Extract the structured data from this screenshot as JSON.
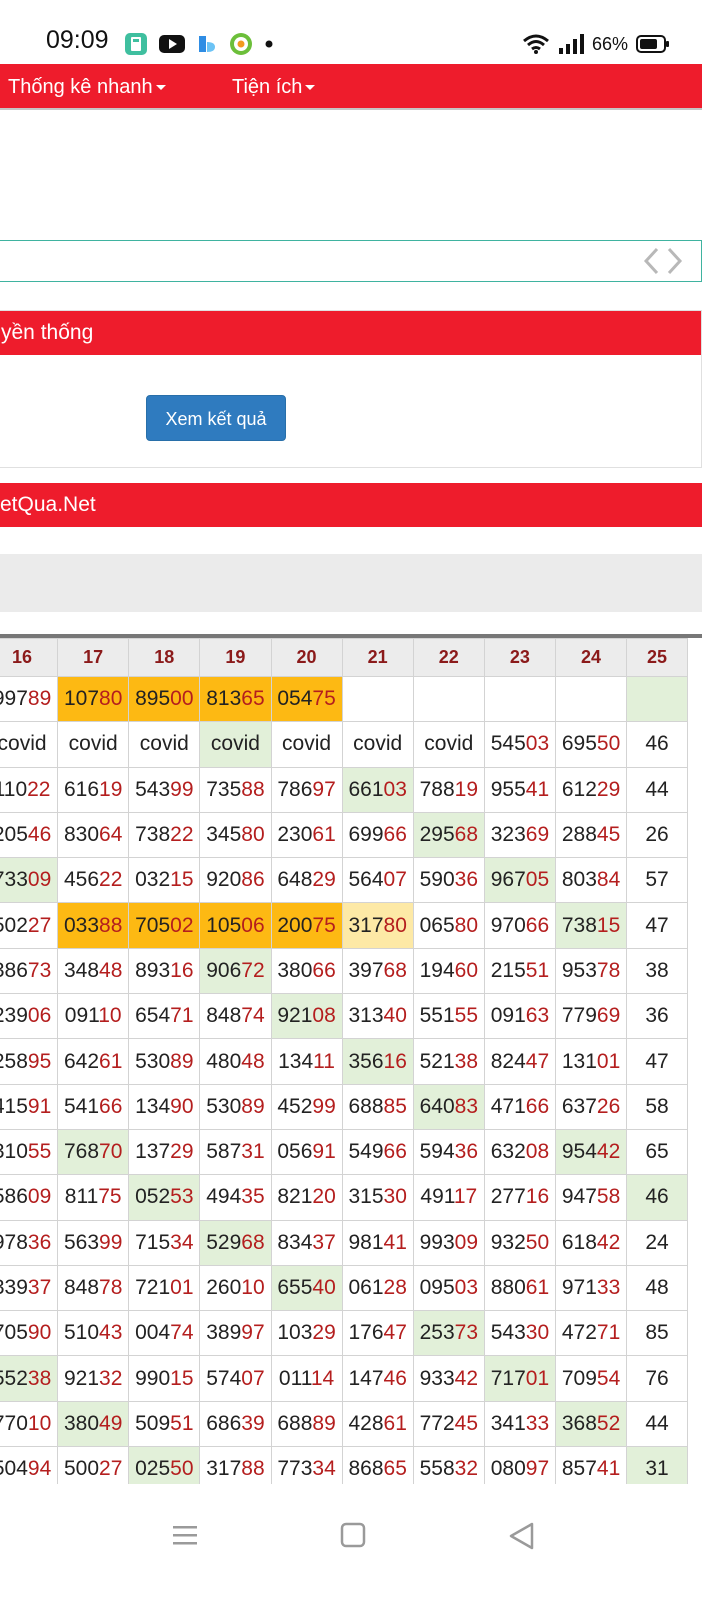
{
  "status_bar": {
    "time": "09:09",
    "battery": "66%"
  },
  "nav": {
    "items": [
      "Thống kê nhanh",
      "Tiện ích"
    ]
  },
  "section1": {
    "title": "yền thống",
    "button": "Xem kết quả"
  },
  "section2": {
    "title": "etQua.Net"
  },
  "table": {
    "headers": [
      "16",
      "17",
      "18",
      "19",
      "20",
      "21",
      "22",
      "23",
      "24",
      "25"
    ],
    "rows": [
      [
        {
          "v": "99789"
        },
        {
          "v": "10780",
          "c": "o"
        },
        {
          "v": "89500",
          "c": "o"
        },
        {
          "v": "81365",
          "c": "o"
        },
        {
          "v": "05475",
          "c": "o"
        },
        {
          "v": ""
        },
        {
          "v": ""
        },
        {
          "v": ""
        },
        {
          "v": ""
        },
        {
          "v": "",
          "c": "g"
        }
      ],
      [
        {
          "v": "covid"
        },
        {
          "v": "covid"
        },
        {
          "v": "covid"
        },
        {
          "v": "covid",
          "c": "g"
        },
        {
          "v": "covid"
        },
        {
          "v": "covid"
        },
        {
          "v": "covid"
        },
        {
          "v": "54503"
        },
        {
          "v": "69550"
        },
        {
          "v": "46"
        }
      ],
      [
        {
          "v": "11022"
        },
        {
          "v": "61619"
        },
        {
          "v": "54399"
        },
        {
          "v": "73588"
        },
        {
          "v": "78697"
        },
        {
          "v": "66103",
          "c": "g"
        },
        {
          "v": "78819"
        },
        {
          "v": "95541"
        },
        {
          "v": "61229"
        },
        {
          "v": "44"
        }
      ],
      [
        {
          "v": "20546"
        },
        {
          "v": "83064"
        },
        {
          "v": "73822"
        },
        {
          "v": "34580"
        },
        {
          "v": "23061"
        },
        {
          "v": "69966"
        },
        {
          "v": "29568",
          "c": "g"
        },
        {
          "v": "32369"
        },
        {
          "v": "28845"
        },
        {
          "v": "26"
        }
      ],
      [
        {
          "v": "73309",
          "c": "g"
        },
        {
          "v": "45622"
        },
        {
          "v": "03215"
        },
        {
          "v": "92086"
        },
        {
          "v": "64829"
        },
        {
          "v": "56407"
        },
        {
          "v": "59036"
        },
        {
          "v": "96705",
          "c": "g"
        },
        {
          "v": "80384"
        },
        {
          "v": "57"
        }
      ],
      [
        {
          "v": "50227"
        },
        {
          "v": "03388",
          "c": "o"
        },
        {
          "v": "70502",
          "c": "o"
        },
        {
          "v": "10506",
          "c": "o"
        },
        {
          "v": "20075",
          "c": "o"
        },
        {
          "v": "31780",
          "c": "y"
        },
        {
          "v": "06580"
        },
        {
          "v": "97066"
        },
        {
          "v": "73815",
          "c": "g"
        },
        {
          "v": "47"
        }
      ],
      [
        {
          "v": "38673"
        },
        {
          "v": "34848"
        },
        {
          "v": "89316"
        },
        {
          "v": "90672",
          "c": "g"
        },
        {
          "v": "38066"
        },
        {
          "v": "39768"
        },
        {
          "v": "19460"
        },
        {
          "v": "21551"
        },
        {
          "v": "95378"
        },
        {
          "v": "38"
        }
      ],
      [
        {
          "v": "23906"
        },
        {
          "v": "09110"
        },
        {
          "v": "65471"
        },
        {
          "v": "84874"
        },
        {
          "v": "92108",
          "c": "g"
        },
        {
          "v": "31340"
        },
        {
          "v": "55155"
        },
        {
          "v": "09163"
        },
        {
          "v": "77969"
        },
        {
          "v": "36"
        }
      ],
      [
        {
          "v": "25895"
        },
        {
          "v": "64261"
        },
        {
          "v": "53089"
        },
        {
          "v": "48048"
        },
        {
          "v": "13411"
        },
        {
          "v": "35616",
          "c": "g"
        },
        {
          "v": "52138"
        },
        {
          "v": "82447"
        },
        {
          "v": "13101"
        },
        {
          "v": "47"
        }
      ],
      [
        {
          "v": "41591"
        },
        {
          "v": "54166"
        },
        {
          "v": "13490"
        },
        {
          "v": "53089"
        },
        {
          "v": "45299"
        },
        {
          "v": "68885"
        },
        {
          "v": "64083",
          "c": "g"
        },
        {
          "v": "47166"
        },
        {
          "v": "63726"
        },
        {
          "v": "58"
        }
      ],
      [
        {
          "v": "31055"
        },
        {
          "v": "76870",
          "c": "g"
        },
        {
          "v": "13729"
        },
        {
          "v": "58731"
        },
        {
          "v": "05691"
        },
        {
          "v": "54966"
        },
        {
          "v": "59436"
        },
        {
          "v": "63208"
        },
        {
          "v": "95442",
          "c": "g"
        },
        {
          "v": "65"
        }
      ],
      [
        {
          "v": "58609"
        },
        {
          "v": "81175"
        },
        {
          "v": "05253",
          "c": "g"
        },
        {
          "v": "49435"
        },
        {
          "v": "82120"
        },
        {
          "v": "31530"
        },
        {
          "v": "49117"
        },
        {
          "v": "27716"
        },
        {
          "v": "94758"
        },
        {
          "v": "46",
          "c": "g"
        }
      ],
      [
        {
          "v": "97836"
        },
        {
          "v": "56399"
        },
        {
          "v": "71534"
        },
        {
          "v": "52968",
          "c": "g"
        },
        {
          "v": "83437"
        },
        {
          "v": "98141"
        },
        {
          "v": "99309"
        },
        {
          "v": "93250"
        },
        {
          "v": "61842"
        },
        {
          "v": "24"
        }
      ],
      [
        {
          "v": "33937"
        },
        {
          "v": "84878"
        },
        {
          "v": "72101"
        },
        {
          "v": "26010"
        },
        {
          "v": "65540",
          "c": "g"
        },
        {
          "v": "06128"
        },
        {
          "v": "09503"
        },
        {
          "v": "88061"
        },
        {
          "v": "97133"
        },
        {
          "v": "48"
        }
      ],
      [
        {
          "v": "70590"
        },
        {
          "v": "51043"
        },
        {
          "v": "00474"
        },
        {
          "v": "38997"
        },
        {
          "v": "10329"
        },
        {
          "v": "17647"
        },
        {
          "v": "25373",
          "c": "g"
        },
        {
          "v": "54330"
        },
        {
          "v": "47271"
        },
        {
          "v": "85"
        }
      ],
      [
        {
          "v": "55238",
          "c": "g"
        },
        {
          "v": "92132"
        },
        {
          "v": "99015"
        },
        {
          "v": "57407"
        },
        {
          "v": "01114"
        },
        {
          "v": "14746"
        },
        {
          "v": "93342"
        },
        {
          "v": "71701",
          "c": "g"
        },
        {
          "v": "70954"
        },
        {
          "v": "76"
        }
      ],
      [
        {
          "v": "77010"
        },
        {
          "v": "38049",
          "c": "g"
        },
        {
          "v": "50951"
        },
        {
          "v": "68639"
        },
        {
          "v": "68889"
        },
        {
          "v": "42861"
        },
        {
          "v": "77245"
        },
        {
          "v": "34133"
        },
        {
          "v": "36852",
          "c": "g"
        },
        {
          "v": "44"
        }
      ],
      [
        {
          "v": "50494"
        },
        {
          "v": "50027"
        },
        {
          "v": "02550",
          "c": "g"
        },
        {
          "v": "31788"
        },
        {
          "v": "77334"
        },
        {
          "v": "86865"
        },
        {
          "v": "55832"
        },
        {
          "v": "08097"
        },
        {
          "v": "85741"
        },
        {
          "v": "31",
          "c": "g"
        }
      ]
    ]
  }
}
